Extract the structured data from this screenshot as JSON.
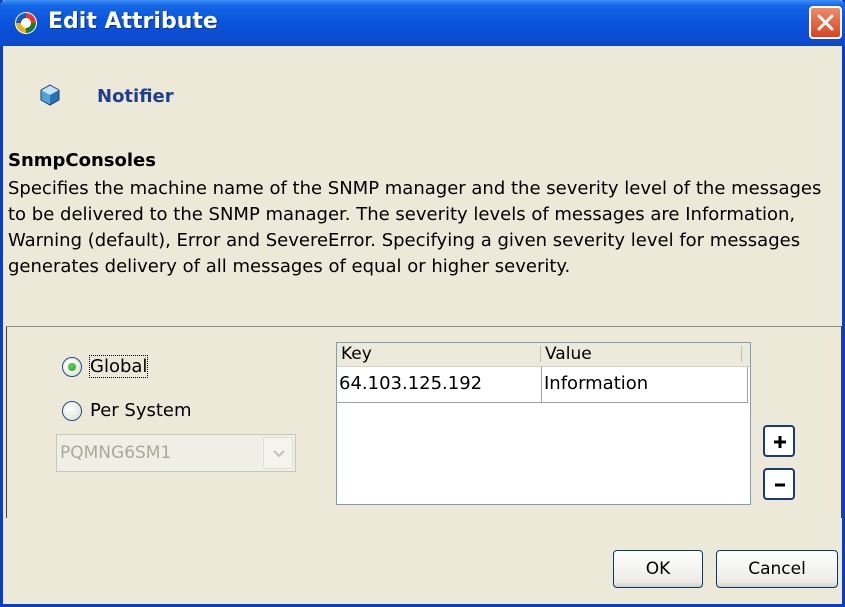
{
  "window": {
    "title": "Edit Attribute",
    "icon": "gear-sync-icon",
    "close_icon": "close-icon"
  },
  "header": {
    "icon": "cube-icon",
    "label": "Notifier"
  },
  "attribute": {
    "name": "SnmpConsoles",
    "description": "Specifies the machine name of the SNMP manager and the severity level of the messages to be delivered to the SNMP manager. The severity levels of messages are Information, Warning (default), Error and  SevereError. Specifying a given severity level for messages generates delivery of all messages of equal or higher severity."
  },
  "scope": {
    "global_label": "Global",
    "per_system_label": "Per System",
    "selected": "Global",
    "system_select_value": "PQMNG6SM1"
  },
  "table": {
    "columns": [
      "Key",
      "Value"
    ],
    "rows": [
      {
        "key": "64.103.125.192",
        "value": "Information"
      }
    ]
  },
  "actions": {
    "add_icon": "plus-icon",
    "remove_icon": "minus-icon",
    "ok_label": "OK",
    "cancel_label": "Cancel"
  },
  "colors": {
    "titlebar": "#0a55dc",
    "dialog_bg": "#ece9d8",
    "header_text": "#1f3f8c",
    "close_button": "#d9441e"
  }
}
